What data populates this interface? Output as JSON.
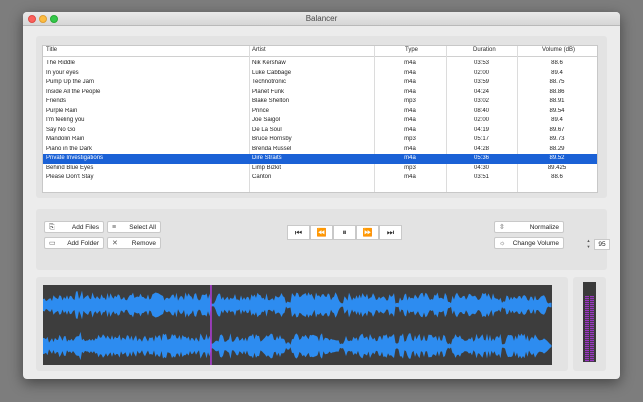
{
  "window": {
    "title": "Balancer"
  },
  "table": {
    "headers": [
      "Title",
      "Artist",
      "Type",
      "Duration",
      "Volume (dB)"
    ],
    "rows": [
      [
        "The Riddle",
        "Nik Kershaw",
        "m4a",
        "03:53",
        "88.6"
      ],
      [
        "In your eyes",
        "Luke Cabbage",
        "m4a",
        "02:00",
        "89.4"
      ],
      [
        "Pump Up the Jam",
        "Technotronic",
        "m4a",
        "03:59",
        "88.75"
      ],
      [
        "Inside All the People",
        "Planet Funk",
        "m4a",
        "04:24",
        "88.86"
      ],
      [
        "Friends",
        "Blake Shelton",
        "mp3",
        "03:02",
        "88.91"
      ],
      [
        "Purple Rain",
        "Prince",
        "m4a",
        "08:40",
        "89.54"
      ],
      [
        "I'm feeling you",
        "Joe Saigol",
        "m4a",
        "02:00",
        "89.4"
      ],
      [
        "Say No Go",
        "De La Soul",
        "m4a",
        "04:19",
        "89.67"
      ],
      [
        "Mandolin Rain",
        "Bruce Hornsby",
        "mp3",
        "05:17",
        "89.73"
      ],
      [
        "Piano in the Dark",
        "Brenda Russel",
        "m4a",
        "04:28",
        "88.29"
      ],
      [
        "Private Investigations",
        "Dire Straits",
        "m4a",
        "05:36",
        "89.52"
      ],
      [
        "Behind Blue Eyes",
        "Limp Bizkit",
        "mp3",
        "04:30",
        "89.425"
      ],
      [
        "Please Don't Stay",
        "Canton",
        "m4a",
        "03:51",
        "88.6"
      ]
    ],
    "selected_index": 10
  },
  "buttons": {
    "add_files": "Add Files",
    "select_all": "Select All",
    "add_folder": "Add Folder",
    "remove": "Remove",
    "normalize": "Normalize",
    "change_volume": "Change Volume"
  },
  "volume_value": "95",
  "transport": {
    "icons": [
      "skip-to-start-icon",
      "rewind-icon",
      "pause-icon",
      "fast-forward-icon",
      "skip-to-end-icon"
    ],
    "glyphs": [
      "⏮",
      "⏪",
      "⏸",
      "⏩",
      "⏭"
    ]
  },
  "playback_position": 0.33,
  "level_meter": 0.83,
  "colors": {
    "selection": "#1a61d6",
    "waveform": "#2d8cf0",
    "playhead": "#b43cdc",
    "meter": "#9b35c2"
  }
}
